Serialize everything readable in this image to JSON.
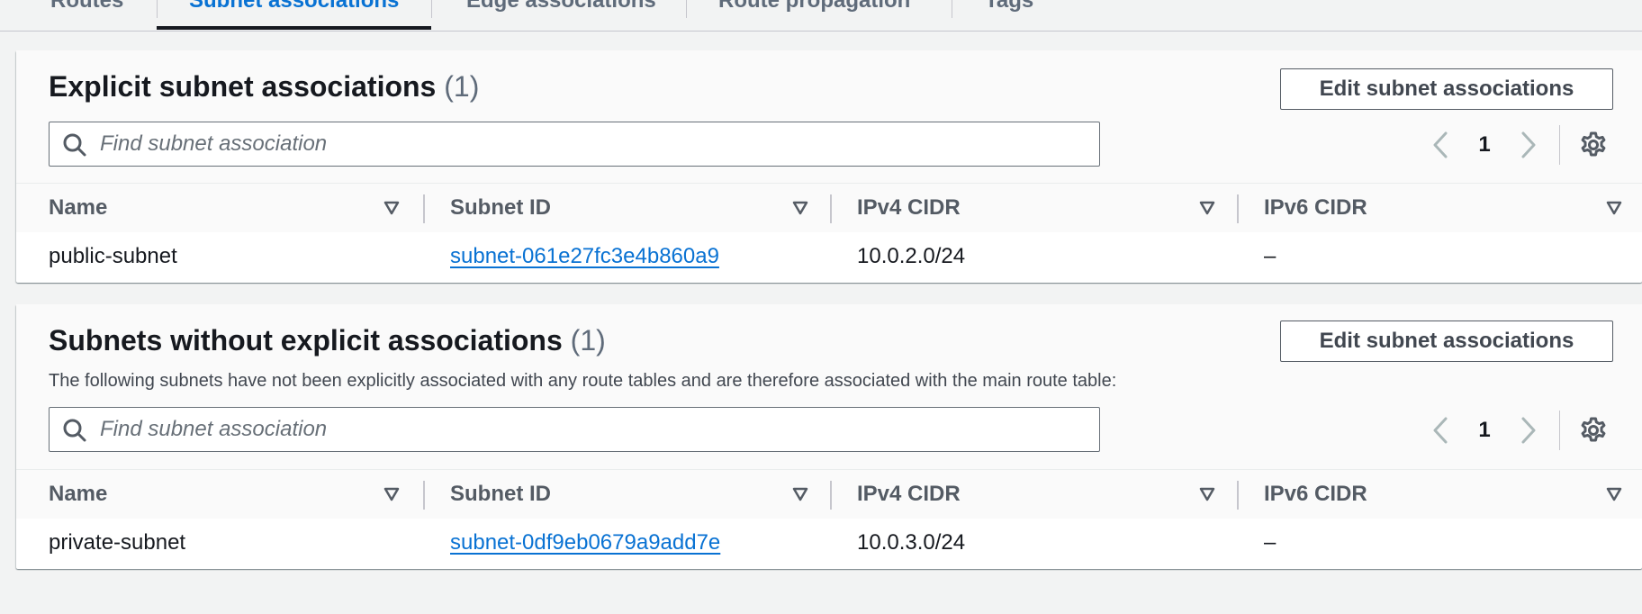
{
  "tabs": [
    {
      "label": "Routes"
    },
    {
      "label": "Subnet associations"
    },
    {
      "label": "Edge associations"
    },
    {
      "label": "Route propagation"
    },
    {
      "label": "Tags"
    }
  ],
  "explicit": {
    "title": "Explicit subnet associations",
    "count": "(1)",
    "edit_label": "Edit subnet associations",
    "search_placeholder": "Find subnet association",
    "page": "1",
    "columns": [
      "Name",
      "Subnet ID",
      "IPv4 CIDR",
      "IPv6 CIDR"
    ],
    "rows": [
      {
        "name": "public-subnet",
        "subnet_id": "subnet-061e27fc3e4b860a9",
        "ipv4": "10.0.2.0/24",
        "ipv6": "–"
      }
    ]
  },
  "implicit": {
    "title": "Subnets without explicit associations",
    "count": "(1)",
    "description": "The following subnets have not been explicitly associated with any route tables and are therefore associated with the main route table:",
    "edit_label": "Edit subnet associations",
    "search_placeholder": "Find subnet association",
    "page": "1",
    "columns": [
      "Name",
      "Subnet ID",
      "IPv4 CIDR",
      "IPv6 CIDR"
    ],
    "rows": [
      {
        "name": "private-subnet",
        "subnet_id": "subnet-0df9eb0679a9add7e",
        "ipv4": "10.0.3.0/24",
        "ipv6": "–"
      }
    ]
  },
  "colors": {
    "link": "#0972d3",
    "active_tab": "#0972d3",
    "text": "#16191f",
    "muted": "#5f6b7a"
  },
  "icons": [
    "search-icon",
    "chevron-left-icon",
    "chevron-right-icon",
    "gear-icon",
    "sort-icon"
  ]
}
